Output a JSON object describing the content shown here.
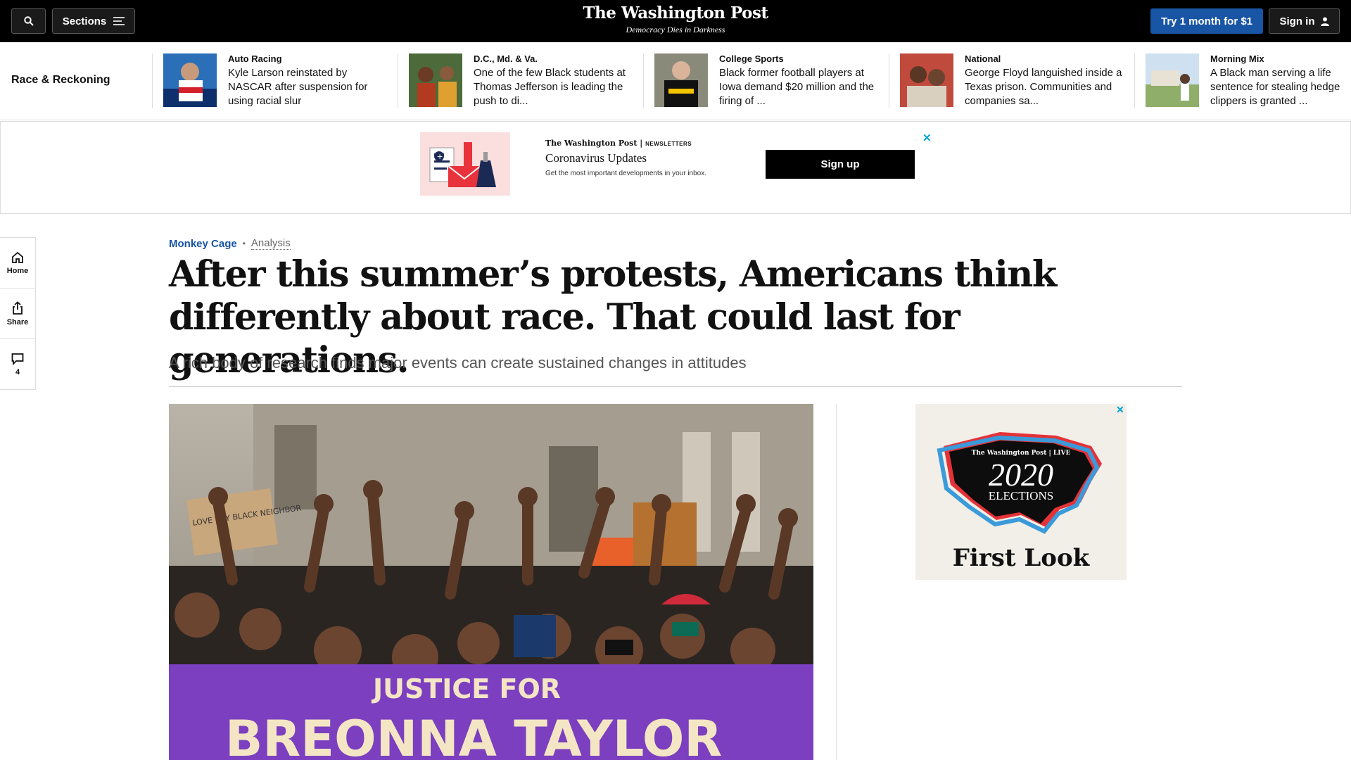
{
  "topbar": {
    "sections_label": "Sections",
    "logo": "The Washington Post",
    "tagline": "Democracy Dies in Darkness",
    "trial_label": "Try 1 month for $1",
    "signin_label": "Sign in"
  },
  "strip": {
    "title": "Race & Reckoning",
    "cards": [
      {
        "kicker": "Auto Racing",
        "headline": "Kyle Larson reinstated by NASCAR after suspension for using racial slur"
      },
      {
        "kicker": "D.C., Md. & Va.",
        "headline": "One of the few Black students at Thomas Jefferson is leading the push to di..."
      },
      {
        "kicker": "College Sports",
        "headline": "Black former football players at Iowa demand $20 million and the firing of ..."
      },
      {
        "kicker": "National",
        "headline": "George Floyd languished inside a Texas prison. Communities and companies sa..."
      },
      {
        "kicker": "Morning Mix",
        "headline": "A Black man serving a life sentence for stealing hedge clippers is granted ..."
      }
    ]
  },
  "newsletter_ad": {
    "brand": "The Washington Post",
    "brand_tag": "NEWSLETTERS",
    "title": "Coronavirus Updates",
    "description": "Get the most important developments in your inbox.",
    "button_label": "Sign up",
    "close": "✕"
  },
  "rail": {
    "home_label": "Home",
    "share_label": "Share",
    "comments_count": "4"
  },
  "article": {
    "section": "Monkey Cage",
    "label": "Analysis",
    "headline": "After this summer’s protests, Americans think differently about race. That could last for generations.",
    "subheadline": "A rich body of research finds major events can create sustained changes in attitudes"
  },
  "photo": {
    "sign_text": "LOVE THY BLACK NEIGHBOR",
    "banner_line1": "JUSTICE FOR",
    "banner_line2": "BREONNA TAYLOR"
  },
  "election_ad": {
    "brand": "The Washington Post | LIVE",
    "year": "2020",
    "word": "ELECTIONS",
    "tagline": "First Look",
    "close": "✕"
  },
  "colors": {
    "accent_blue": "#1955a5",
    "ad_close": "#00a3d9",
    "banner_purple": "#7b3fbf"
  }
}
